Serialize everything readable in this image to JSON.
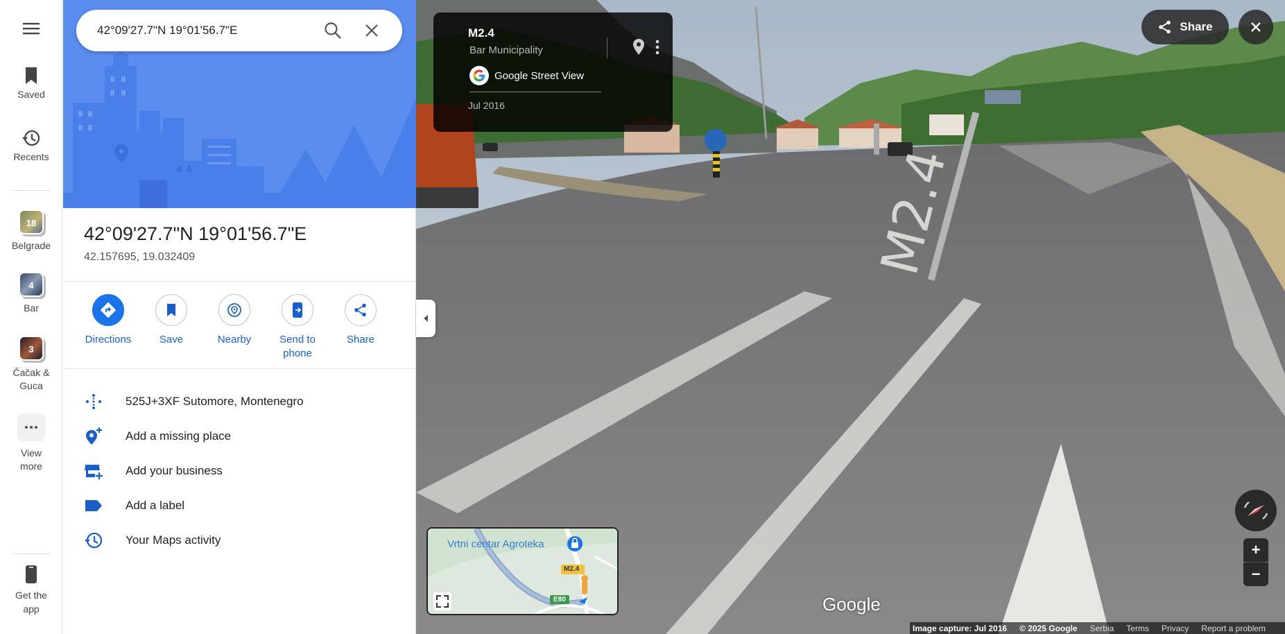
{
  "rail": {
    "menu_icon": "menu-icon",
    "saved_label": "Saved",
    "recents_label": "Recents",
    "recent_places": [
      {
        "label": "Belgrade",
        "count": "18"
      },
      {
        "label": "Bar",
        "count": "4"
      },
      {
        "label": "Čačak & Guca",
        "count": "3"
      }
    ],
    "view_more_label": "View more",
    "get_app_label": "Get the app"
  },
  "search": {
    "value": "42°09'27.7\"N 19°01'56.7\"E"
  },
  "place": {
    "title": "42°09'27.7\"N 19°01'56.7\"E",
    "coords": "42.157695, 19.032409"
  },
  "actions": [
    {
      "label": "Directions",
      "icon": "directions-icon"
    },
    {
      "label": "Save",
      "icon": "bookmark-icon"
    },
    {
      "label": "Nearby",
      "icon": "nearby-icon"
    },
    {
      "label": "Send to phone",
      "icon": "send-to-phone-icon"
    },
    {
      "label": "Share",
      "icon": "share-icon"
    }
  ],
  "info_rows": [
    {
      "text": "525J+3XF Sutomore, Montenegro",
      "icon": "plus-code-icon"
    },
    {
      "text": "Add a missing place",
      "icon": "add-place-icon"
    },
    {
      "text": "Add your business",
      "icon": "add-business-icon"
    },
    {
      "text": "Add a label",
      "icon": "label-icon"
    },
    {
      "text": "Your Maps activity",
      "icon": "history-icon"
    }
  ],
  "streetview": {
    "road_name": "M2.4",
    "municipality": "Bar Municipality",
    "source": "Google Street View",
    "date": "Jul 2016",
    "share_label": "Share",
    "road_marking": "M2.4",
    "google_logo": "Google"
  },
  "minimap": {
    "place_label": "Vrtni centar Agroteka",
    "shield_m": "M2.4",
    "shield_e": "E80"
  },
  "footer": {
    "capture": "Image capture: Jul 2016",
    "copyright": "© 2025 Google",
    "links": [
      "Serbia",
      "Terms",
      "Privacy",
      "Report a problem"
    ]
  },
  "colors": {
    "accent": "#1a73e8",
    "hero": "#5b8def"
  }
}
